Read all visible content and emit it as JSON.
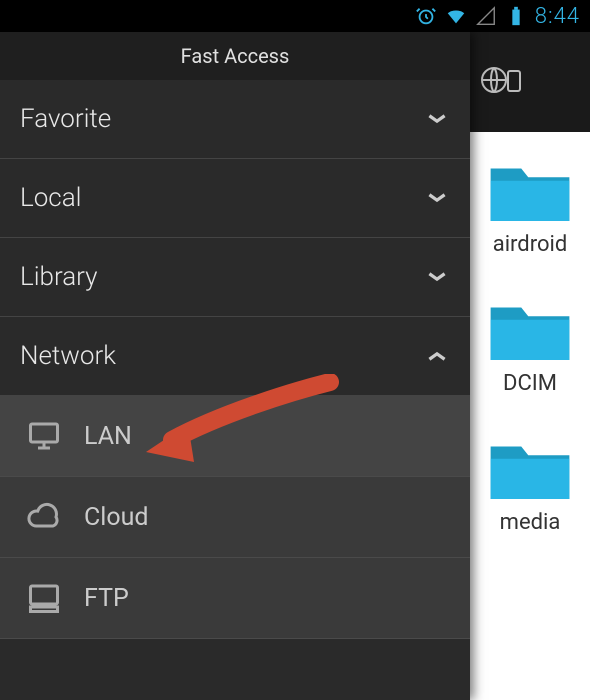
{
  "status": {
    "time": "8:44"
  },
  "drawer": {
    "title": "Fast Access",
    "sections": [
      {
        "label": "Favorite",
        "expanded": false
      },
      {
        "label": "Local",
        "expanded": false
      },
      {
        "label": "Library",
        "expanded": false
      },
      {
        "label": "Network",
        "expanded": true,
        "children": [
          {
            "label": "LAN",
            "icon": "monitor"
          },
          {
            "label": "Cloud",
            "icon": "cloud"
          },
          {
            "label": "FTP",
            "icon": "server"
          }
        ]
      }
    ]
  },
  "folders": [
    {
      "label": "airdroid"
    },
    {
      "label": "DCIM"
    },
    {
      "label": "media"
    }
  ]
}
